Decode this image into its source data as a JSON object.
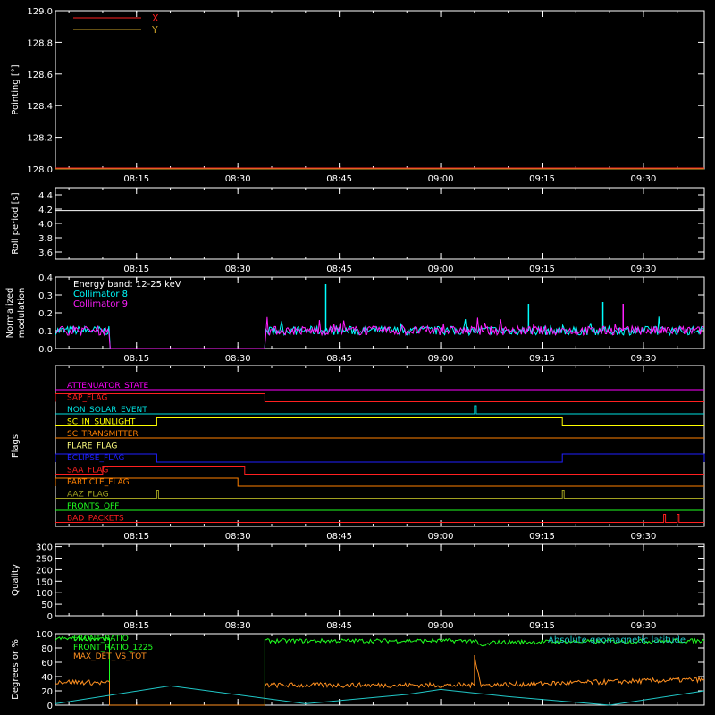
{
  "colors": {
    "axis": "#ffffff",
    "x_series": "#ff2020",
    "y_series": "#c8a028",
    "collimator8": "#00ffff",
    "collimator9": "#ff20ff",
    "front_ratio": "#20ff20",
    "max_det": "#ff9020",
    "latitude": "#20c8c8"
  },
  "chart_data": [
    {
      "id": "pointing",
      "type": "line",
      "ylabel": "Pointing [°]",
      "ylim": [
        128.0,
        129.0
      ],
      "yticks": [
        "129.0",
        "128.8",
        "128.6",
        "128.4",
        "128.2",
        "128.0"
      ],
      "xticks": [
        "08:15",
        "08:30",
        "08:45",
        "09:00",
        "09:15",
        "09:30"
      ],
      "legend": [
        "X",
        "Y"
      ],
      "series": [
        {
          "name": "X",
          "x": [
            "08:03",
            "09:39"
          ],
          "values": [
            128.0,
            128.0
          ]
        },
        {
          "name": "Y",
          "x": [
            "08:03",
            "09:39"
          ],
          "values": [
            128.0,
            128.0
          ]
        }
      ]
    },
    {
      "id": "roll",
      "type": "line",
      "ylabel": "Roll period [s]",
      "ylim": [
        3.5,
        4.5
      ],
      "yticks": [
        "4.4",
        "4.2",
        "4.0",
        "3.8",
        "3.6"
      ],
      "xticks": [
        "08:15",
        "08:30",
        "08:45",
        "09:00",
        "09:15",
        "09:30"
      ],
      "series": [
        {
          "name": "",
          "x": [
            "08:03",
            "09:39"
          ],
          "values": [
            4.18,
            4.18
          ]
        }
      ]
    },
    {
      "id": "modulation",
      "type": "line",
      "ylabel": [
        "Normalized",
        "modulation"
      ],
      "ylim": [
        0.0,
        0.4
      ],
      "yticks": [
        "0.4",
        "0.3",
        "0.2",
        "0.1",
        "0.0"
      ],
      "xticks": [
        "08:15",
        "08:30",
        "08:45",
        "09:00",
        "09:15",
        "09:30"
      ],
      "legend": [
        "Energy band: 12-25 keV",
        "Collimator 8",
        "Collimator 9"
      ],
      "series": [
        {
          "name": "Collimator 8",
          "baseline": 0.1,
          "gaps": [
            [
              "08:11",
              "08:34"
            ]
          ],
          "spikes": [
            [
              "08:43",
              0.36
            ],
            [
              "09:13",
              0.25
            ],
            [
              "09:24",
              0.26
            ]
          ]
        },
        {
          "name": "Collimator 9",
          "baseline": 0.1,
          "gaps": [
            [
              "08:11",
              "08:34"
            ]
          ],
          "spikes": [
            [
              "09:27",
              0.25
            ]
          ]
        }
      ]
    },
    {
      "id": "flags",
      "type": "line",
      "ylabel": "Flags",
      "xticks": [
        "08:15",
        "08:30",
        "08:45",
        "09:00",
        "09:15",
        "09:30"
      ],
      "flags": [
        {
          "name": "ATTENUATOR_STATE",
          "color": "#ff00ff",
          "segments": []
        },
        {
          "name": "SAP_FLAG",
          "color": "#ff2020",
          "segments": [
            [
              "08:03",
              "08:34"
            ]
          ]
        },
        {
          "name": "NON_SOLAR_EVENT",
          "color": "#00e0e0",
          "segments": [
            [
              "09:05",
              "09:05"
            ]
          ]
        },
        {
          "name": "SC_IN_SUNLIGHT",
          "color": "#ffff00",
          "segments": [
            [
              "08:18",
              "09:18"
            ]
          ]
        },
        {
          "name": "SC_TRANSMITTER",
          "color": "#ff8000",
          "segments": []
        },
        {
          "name": "FLARE_FLAG",
          "color": "#ffff80",
          "segments": []
        },
        {
          "name": "ECLIPSE_FLAG",
          "color": "#2020ff",
          "segments": [
            [
              "08:03",
              "08:18"
            ],
            [
              "09:18",
              "09:39"
            ]
          ]
        },
        {
          "name": "SAA_FLAG",
          "color": "#ff2020",
          "segments": [
            [
              "08:10",
              "08:31"
            ]
          ]
        },
        {
          "name": "PARTICLE_FLAG",
          "color": "#ff8000",
          "segments": [
            [
              "08:03",
              "08:30"
            ]
          ]
        },
        {
          "name": "AAZ_FLAG",
          "color": "#a0a020",
          "segments": [
            [
              "08:18",
              "08:18"
            ],
            [
              "09:18",
              "09:18"
            ]
          ]
        },
        {
          "name": "FRONTS_OFF",
          "color": "#20ff20",
          "segments": []
        },
        {
          "name": "BAD_PACKETS",
          "color": "#ff2020",
          "segments": [
            [
              "09:33",
              "09:33"
            ],
            [
              "09:35",
              "09:35"
            ]
          ]
        }
      ]
    },
    {
      "id": "quality",
      "type": "line",
      "ylabel": "Quality",
      "ylim": [
        0,
        310
      ],
      "yticks": [
        "300",
        "250",
        "200",
        "150",
        "100",
        "50",
        "0"
      ],
      "xticks": [
        "08:15",
        "08:30",
        "08:45",
        "09:00",
        "09:15",
        "09:30"
      ],
      "series": []
    },
    {
      "id": "ratios",
      "type": "line",
      "ylabel": "Degrees or %",
      "ylim": [
        0,
        100
      ],
      "yticks": [
        "100",
        "80",
        "60",
        "40",
        "20",
        "0"
      ],
      "xticks": [
        "08:15",
        "08:30",
        "08:45",
        "09:00",
        "09:15",
        "09:30"
      ],
      "legend": [
        "FRONT_RATIO",
        "FRONT_RATIO_1225",
        "MAX_DET_VS_TOT"
      ],
      "right_label": "Absolute geomagnetic latitude",
      "series": [
        {
          "name": "FRONT_RATIO",
          "values": [
            [
              "08:03",
              93
            ],
            [
              "08:11",
              93
            ],
            [
              "08:11",
              0
            ],
            [
              "08:34",
              0
            ],
            [
              "08:34",
              90
            ],
            [
              "09:05",
              90
            ],
            [
              "09:06",
              82
            ],
            [
              "09:08",
              88
            ],
            [
              "09:39",
              90
            ]
          ]
        },
        {
          "name": "MAX_DET_VS_TOT",
          "values": [
            [
              "08:03",
              33
            ],
            [
              "08:11",
              31
            ],
            [
              "08:11",
              0
            ],
            [
              "08:34",
              0
            ],
            [
              "08:34",
              28
            ],
            [
              "09:05",
              28
            ],
            [
              "09:05",
              70
            ],
            [
              "09:06",
              28
            ],
            [
              "09:39",
              36
            ]
          ]
        },
        {
          "name": "Absolute geomagnetic latitude",
          "values": [
            [
              "08:03",
              2
            ],
            [
              "08:20",
              27
            ],
            [
              "08:40",
              2
            ],
            [
              "08:55",
              15
            ],
            [
              "09:00",
              22
            ],
            [
              "09:10",
              12
            ],
            [
              "09:25",
              0
            ],
            [
              "09:39",
              20
            ]
          ]
        }
      ]
    }
  ]
}
